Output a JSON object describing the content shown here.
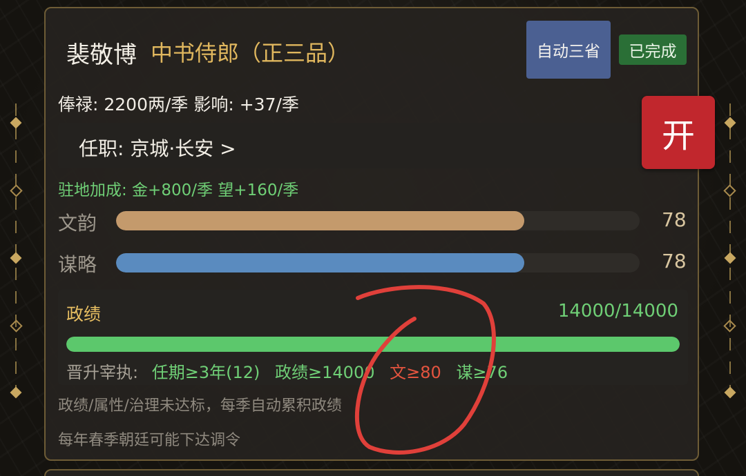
{
  "official": {
    "name": "裴敬博",
    "rank": "中书侍郎（正三品）",
    "auto_button": "自动三省",
    "status": "已完成",
    "salary_line": "俸禄: 2200两/季   影响: +37/季",
    "post_label": "任职: 京城·长安  >",
    "toggle_button": "开",
    "station_bonus": "驻地加成: 金+800/季  望+160/季"
  },
  "attributes": [
    {
      "label": "文韵",
      "value": "78",
      "fraction": 0.78,
      "color": "#c49a6c"
    },
    {
      "label": "谋略",
      "value": "78",
      "fraction": 0.78,
      "color": "#5a8bbf"
    }
  ],
  "merit": {
    "label": "政绩",
    "value": "14000/14000",
    "fraction": 1.0,
    "promotion_label": "晋升宰执:",
    "conditions": [
      {
        "text": "任期≥3年(12)",
        "met": true
      },
      {
        "text": "政绩≥14000",
        "met": true
      },
      {
        "text": "文≥80",
        "met": false
      },
      {
        "text": "谋≥76",
        "met": true
      }
    ]
  },
  "notes": [
    "政绩/属性/治理未达标，每季自动累积政绩",
    "每年春季朝廷可能下达调令"
  ],
  "colors": {
    "accent_gold": "#e0b75e",
    "positive_green": "#6fcf76",
    "negative_red": "#e4543f",
    "toggle_red": "#c1272d",
    "button_blue": "#4b6092"
  }
}
